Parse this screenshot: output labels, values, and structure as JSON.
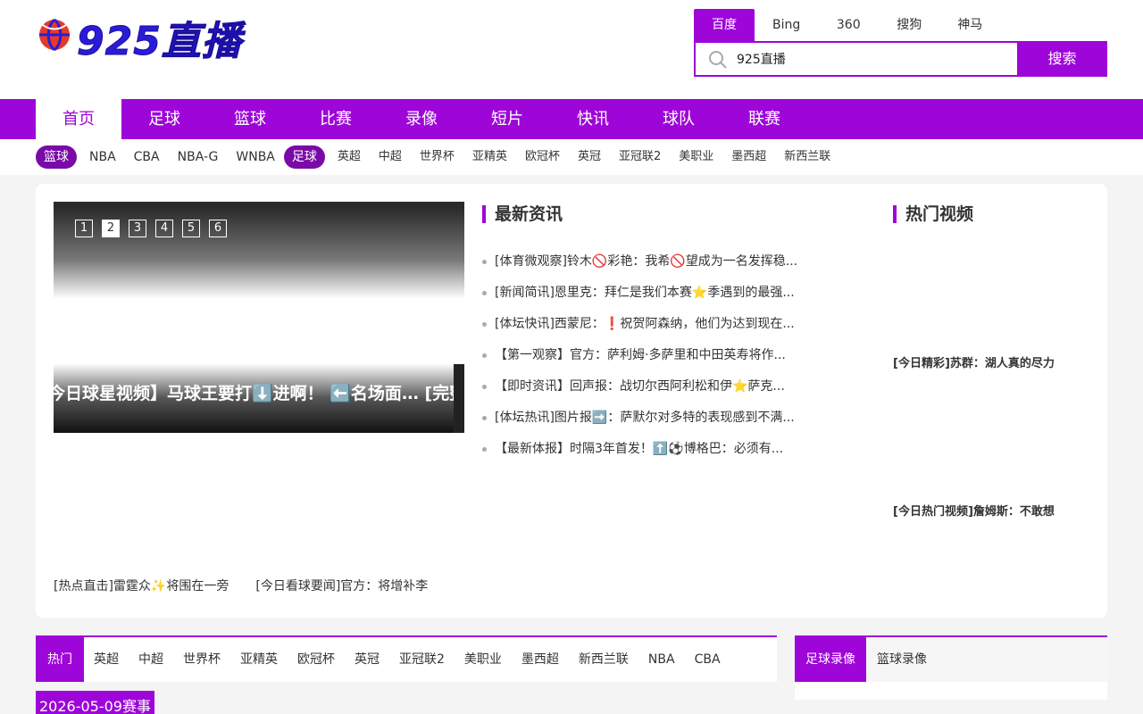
{
  "colors": {
    "brand": "#9e05d8",
    "logo": "#2a1cd6"
  },
  "logo": {
    "text": "925直播",
    "icon": "basketball-icon"
  },
  "search": {
    "engines": [
      "百度",
      "Bing",
      "360",
      "搜狗",
      "神马"
    ],
    "active_engine": "百度",
    "value": "925直播",
    "button": "搜索"
  },
  "main_nav": [
    "首页",
    "足球",
    "篮球",
    "比赛",
    "录像",
    "短片",
    "快讯",
    "球队",
    "联赛"
  ],
  "sub_nav": {
    "basketball_pill": "篮球",
    "basketball": [
      "NBA",
      "CBA",
      "NBA-G",
      "WNBA"
    ],
    "football_pill": "足球",
    "football": [
      "英超",
      "中超",
      "世界杯",
      "亚精英",
      "欧冠杯",
      "英冠",
      "亚冠联2",
      "美职业",
      "墨西超",
      "新西兰联"
    ]
  },
  "slider": {
    "numbers": [
      "1",
      "2",
      "3",
      "4",
      "5",
      "6"
    ],
    "active": "2",
    "caption": "今日球星视频】马球王要打⬇️进啊！ ⬅️名场面… [完整"
  },
  "latest_news": {
    "title": "最新资讯",
    "items": [
      "[体育微观察]铃木🚫彩艳：我希🚫望成为一名发挥稳...",
      "[新闻简讯]恩里克：拜仁是我们本赛⭐季遇到的最强...",
      "[体坛快讯]西蒙尼：❗祝贺阿森纳，他们为达到现在...",
      "【第一观察】官方：萨利姆·多萨里和中田英寿将作...",
      "【即时资讯】回声报：战切尔西阿利松和伊⭐萨克...",
      "[体坛热讯]图片报➡️：萨默尔对多特的表现感到不满...",
      "【最新体报】时隔3年首发！⬆️⚽博格巴：必须有..."
    ]
  },
  "hot_videos": {
    "title": "热门视频",
    "items": [
      "[今日精彩]苏群：湖人真的尽力",
      "[今日热门视频]詹姆斯：不敢想"
    ]
  },
  "bottom_links": [
    "[热点直击]雷霆众✨将围在一旁",
    "[今日看球要闻]官方：将增补李"
  ],
  "schedule_tabs": [
    "热门",
    "英超",
    "中超",
    "世界杯",
    "亚精英",
    "欧冠杯",
    "英冠",
    "亚冠联2",
    "美职业",
    "墨西超",
    "新西兰联",
    "NBA",
    "CBA"
  ],
  "schedule_date": "2026-05-09赛事",
  "video_tabs": [
    "足球录像",
    "篮球录像"
  ]
}
